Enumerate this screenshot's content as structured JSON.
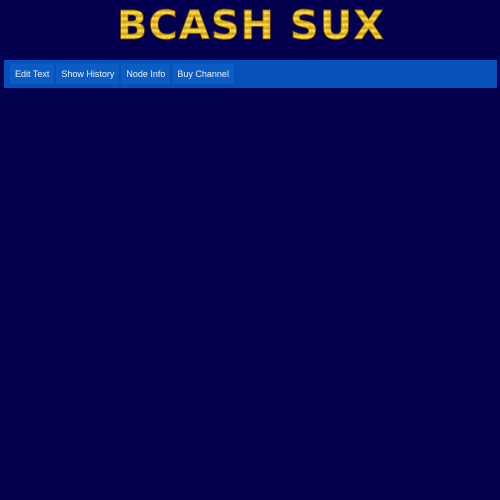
{
  "header": {
    "logo_text": "BCASH SUX",
    "logo_colors": {
      "gold_light": "#f7d93a",
      "gold_mid": "#e0b41a",
      "gold_dark": "#b9860c",
      "outline": "#6e4a05"
    }
  },
  "toolbar": {
    "background": "#0651b9",
    "buttons": [
      {
        "id": "edit-text",
        "label": "Edit Text"
      },
      {
        "id": "show-history",
        "label": "Show History"
      },
      {
        "id": "node-info",
        "label": "Node Info"
      },
      {
        "id": "buy-channel",
        "label": "Buy Channel"
      }
    ]
  },
  "page": {
    "background": "#03004f"
  }
}
